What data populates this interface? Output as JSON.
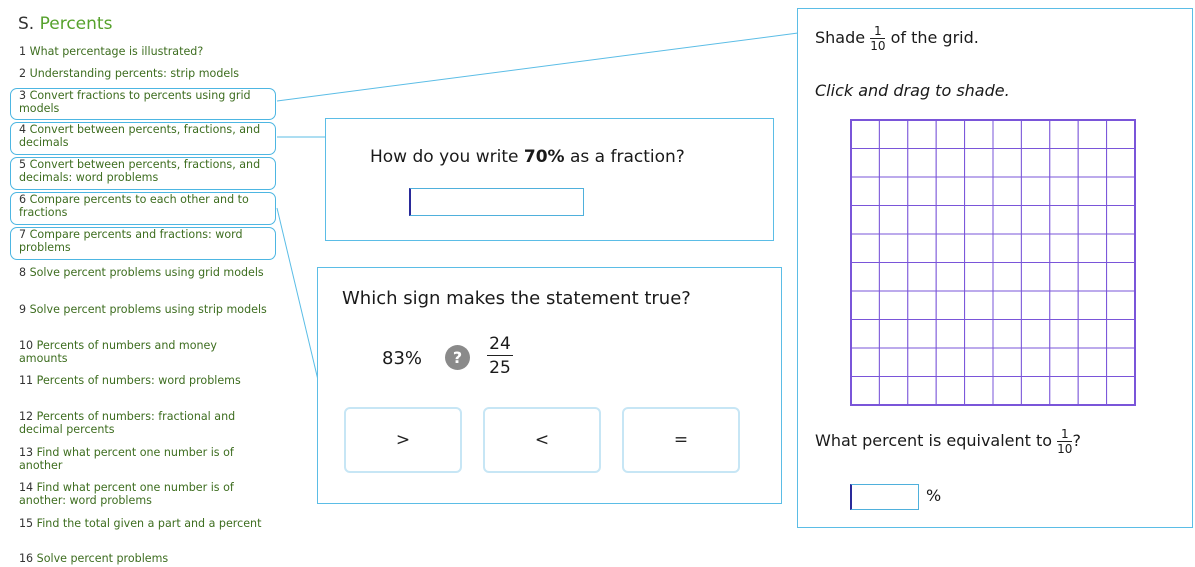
{
  "sidebar": {
    "section_number": "S.",
    "section_title": "Percents",
    "skills": [
      {
        "num": "1",
        "label": "What percentage is illustrated?"
      },
      {
        "num": "2",
        "label": "Understanding percents: strip models"
      },
      {
        "num": "3",
        "label": "Convert fractions to percents using grid models"
      },
      {
        "num": "4",
        "label": "Convert between percents, fractions, and decimals"
      },
      {
        "num": "5",
        "label": "Convert between percents, fractions, and decimals: word problems"
      },
      {
        "num": "6",
        "label": "Compare percents to each other and to fractions"
      },
      {
        "num": "7",
        "label": "Compare percents and fractions: word problems"
      },
      {
        "num": "8",
        "label": "Solve percent problems using grid models"
      },
      {
        "num": "9",
        "label": "Solve percent problems using strip models"
      },
      {
        "num": "10",
        "label": "Percents of numbers and money amounts"
      },
      {
        "num": "11",
        "label": "Percents of numbers: word problems"
      },
      {
        "num": "12",
        "label": "Percents of numbers: fractional and decimal percents"
      },
      {
        "num": "13",
        "label": "Find what percent one number is of another"
      },
      {
        "num": "14",
        "label": "Find what percent one number is of another: word problems"
      },
      {
        "num": "15",
        "label": "Find the total given a part and a percent"
      },
      {
        "num": "16",
        "label": "Solve percent problems"
      }
    ]
  },
  "q1": {
    "prefix": "How do you write ",
    "bold": "70%",
    "suffix": " as a fraction?",
    "answer_value": ""
  },
  "q2": {
    "question": "Which sign makes the statement true?",
    "percent": "83%",
    "help_icon": "?",
    "fraction_num": "24",
    "fraction_den": "25",
    "options": [
      ">",
      "<",
      "="
    ]
  },
  "q3": {
    "shade_prefix": "Shade",
    "fraction_num": "1",
    "fraction_den": "10",
    "shade_suffix": "of the grid.",
    "instruction": "Click and drag to shade.",
    "grid_rows": 10,
    "grid_cols": 10,
    "grid_color": "#7a55d9",
    "equiv_prefix": "What percent is equivalent to",
    "equiv_suffix": "?",
    "answer_value": "",
    "percent_sign": "%"
  },
  "colors": {
    "skill_green": "#3d6d1f",
    "title_green": "#56a12c",
    "highlight_blue": "#4db6e2"
  }
}
